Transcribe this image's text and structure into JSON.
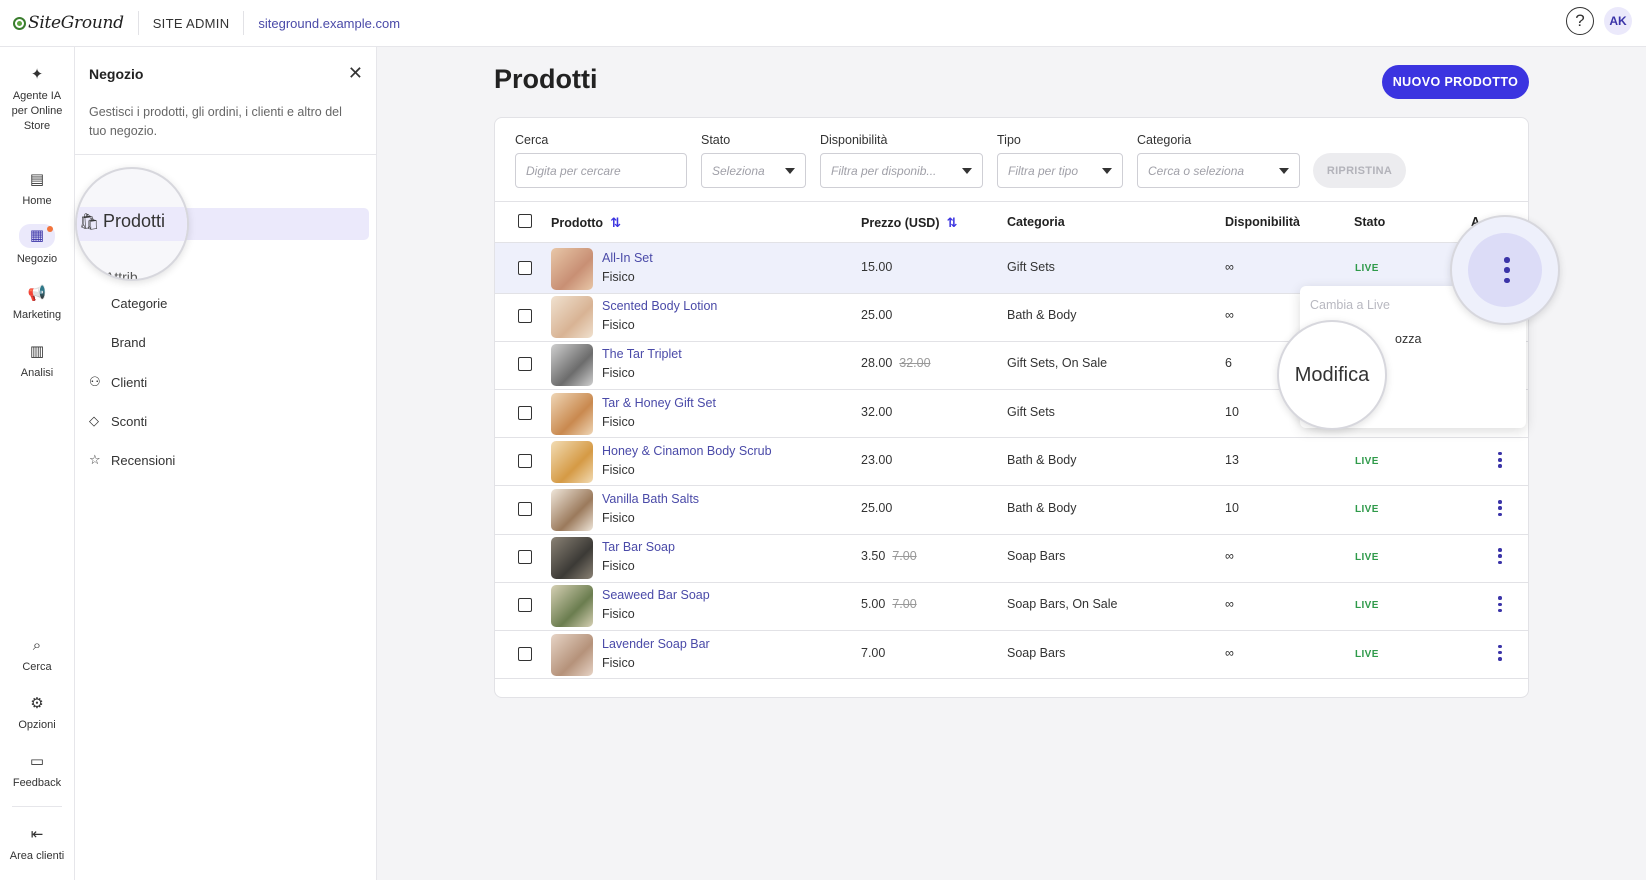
{
  "topbar": {
    "logo_text": "SiteGround",
    "section": "SITE ADMIN",
    "site_url": "siteground.example.com",
    "help_glyph": "?",
    "avatar_initials": "AK"
  },
  "rail": {
    "items": [
      {
        "label": "Agente IA per Online Store",
        "icon": "sparkle-icon"
      },
      {
        "label": "Home",
        "icon": "home-icon"
      },
      {
        "label": "Negozio",
        "icon": "store-icon"
      },
      {
        "label": "Marketing",
        "icon": "megaphone-icon"
      },
      {
        "label": "Analisi",
        "icon": "chart-icon"
      },
      {
        "label": "Cerca",
        "icon": "search-icon"
      },
      {
        "label": "Opzioni",
        "icon": "gear-icon"
      },
      {
        "label": "Feedback",
        "icon": "feedback-icon"
      },
      {
        "label": "Area clienti",
        "icon": "exit-icon"
      }
    ],
    "notification_color": "#f2743c"
  },
  "panel": {
    "title": "Negozio",
    "description": "Gestisci i prodotti, gli ordini, i clienti e altro del tuo negozio.",
    "active_item": "Prodotti",
    "zoom_partial_label": "Attrib",
    "subitems": [
      "Categorie",
      "Brand"
    ],
    "items": [
      {
        "label": "Clienti",
        "icon": "people-icon"
      },
      {
        "label": "Sconti",
        "icon": "tag-icon"
      },
      {
        "label": "Recensioni",
        "icon": "star-icon"
      }
    ]
  },
  "main": {
    "title": "Prodotti",
    "new_button": "NUOVO PRODOTTO",
    "accent_color": "#3b34e0"
  },
  "filters": {
    "search": {
      "label": "Cerca",
      "placeholder": "Digita per cercare"
    },
    "status": {
      "label": "Stato",
      "placeholder": "Seleziona"
    },
    "availability": {
      "label": "Disponibilità",
      "placeholder": "Filtra per disponib..."
    },
    "type": {
      "label": "Tipo",
      "placeholder": "Filtra per tipo"
    },
    "category": {
      "label": "Categoria",
      "placeholder": "Cerca o seleziona"
    },
    "reset": "RIPRISTINA"
  },
  "table": {
    "headers": {
      "product": "Prodotto",
      "price": "Prezzo (USD)",
      "category": "Categoria",
      "availability": "Disponibilità",
      "status": "Stato",
      "actions": "A"
    },
    "rows": [
      {
        "name": "All-In Set",
        "type": "Fisico",
        "price": "15.00",
        "old_price": "",
        "category": "Gift Sets",
        "availability": "∞",
        "status": "LIVE"
      },
      {
        "name": "Scented Body Lotion",
        "type": "Fisico",
        "price": "25.00",
        "old_price": "",
        "category": "Bath & Body",
        "availability": "∞",
        "status": ""
      },
      {
        "name": "The Tar Triplet",
        "type": "Fisico",
        "price": "28.00",
        "old_price": "32.00",
        "category": "Gift Sets, On Sale",
        "availability": "6",
        "status": ""
      },
      {
        "name": "Tar & Honey Gift Set",
        "type": "Fisico",
        "price": "32.00",
        "old_price": "",
        "category": "Gift Sets",
        "availability": "10",
        "status": ""
      },
      {
        "name": "Honey & Cinamon Body Scrub",
        "type": "Fisico",
        "price": "23.00",
        "old_price": "",
        "category": "Bath & Body",
        "availability": "13",
        "status": "LIVE"
      },
      {
        "name": "Vanilla Bath Salts",
        "type": "Fisico",
        "price": "25.00",
        "old_price": "",
        "category": "Bath & Body",
        "availability": "10",
        "status": "LIVE"
      },
      {
        "name": "Tar Bar Soap",
        "type": "Fisico",
        "price": "3.50",
        "old_price": "7.00",
        "category": "Soap Bars",
        "availability": "∞",
        "status": "LIVE"
      },
      {
        "name": "Seaweed Bar Soap",
        "type": "Fisico",
        "price": "5.00",
        "old_price": "7.00",
        "category": "Soap Bars, On Sale",
        "availability": "∞",
        "status": "LIVE"
      },
      {
        "name": "Lavender Soap Bar",
        "type": "Fisico",
        "price": "7.00",
        "old_price": "",
        "category": "Soap Bars",
        "availability": "∞",
        "status": "LIVE"
      }
    ],
    "live_color": "#2f9a4a"
  },
  "row_menu": {
    "items": [
      "Cambia a Live",
      "ozza"
    ],
    "zoom_label": "Modifica"
  }
}
